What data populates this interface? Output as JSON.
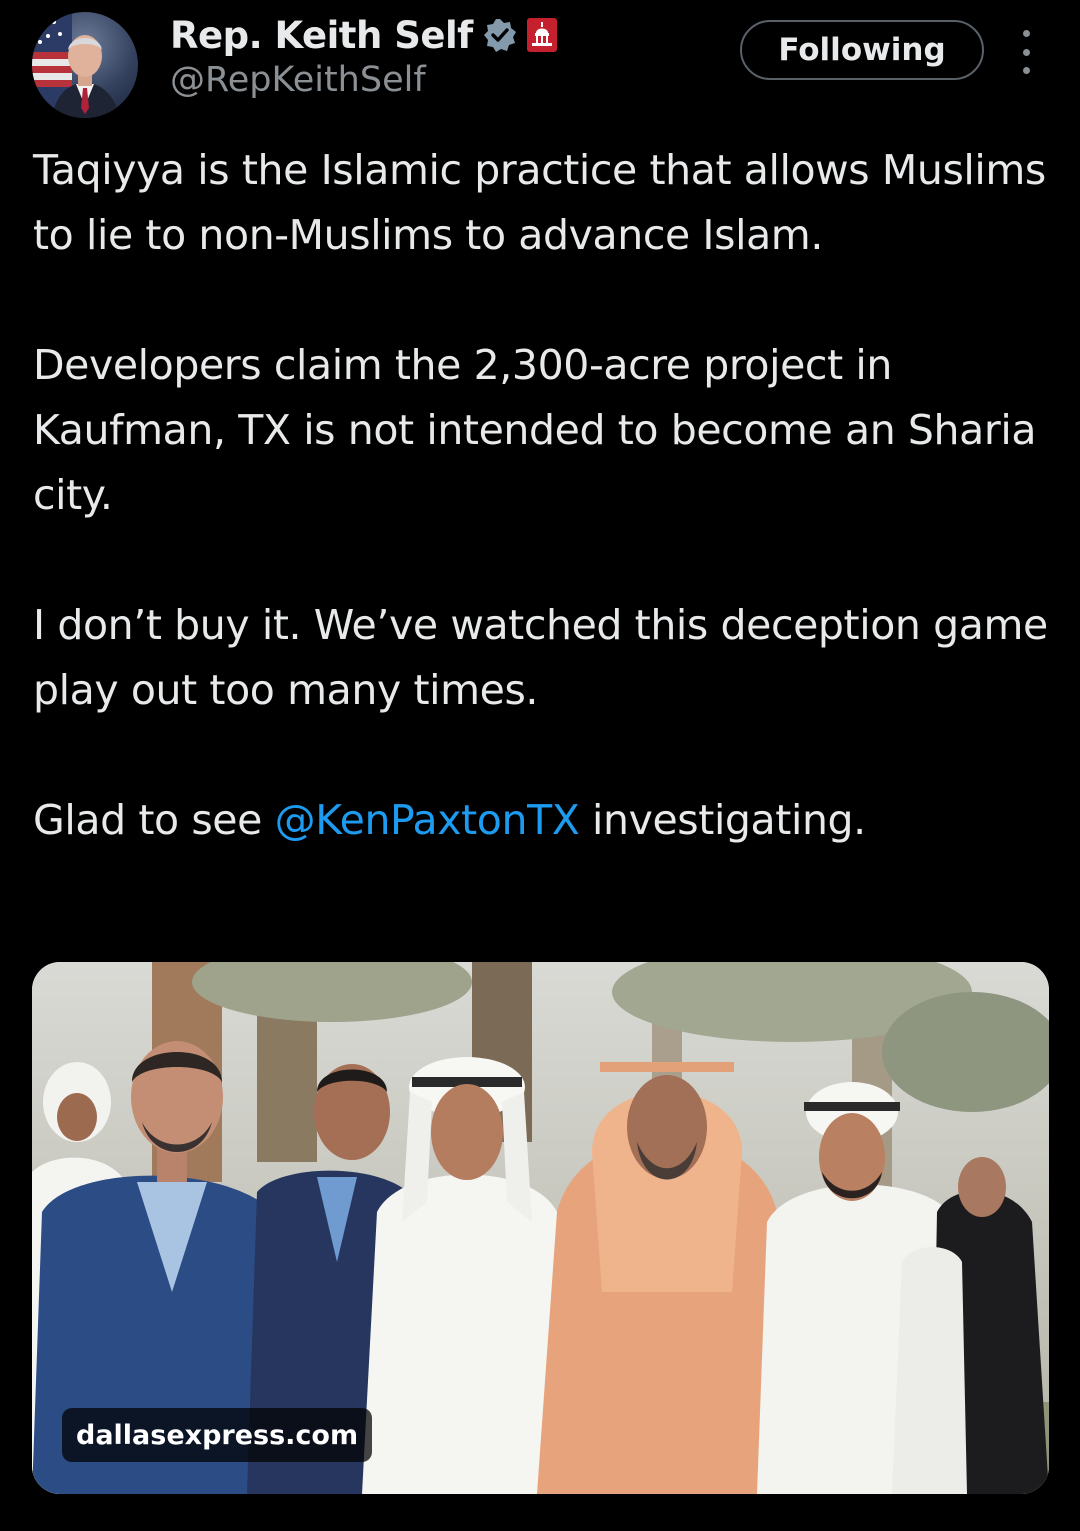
{
  "author": {
    "display_name": "Rep. Keith Self",
    "handle": "@RepKeithSelf",
    "avatar_icon": "avatar-photo",
    "badges": [
      "verified-icon",
      "capitol-icon"
    ],
    "verified_color": "#829aab",
    "capitol_badge_color": "#c4202e"
  },
  "follow_button": {
    "label": "Following"
  },
  "more_menu": {
    "icon": "more-vertical-icon"
  },
  "tweet": {
    "paragraph_1": "Taqiyya is the Islamic practice that allows Muslims to lie to non-Muslims to advance Islam.",
    "paragraph_2": "Developers claim the 2,300-acre project in Kaufman, TX is not intended to become an Sharia city.",
    "paragraph_3": "I don’t buy it. We’ve watched this deception game play out too many times.",
    "paragraph_4_before": "Glad to see ",
    "paragraph_4_mention": "@KenPaxtonTX",
    "paragraph_4_after": " investigating.",
    "mention_color": "#1d9bf0"
  },
  "media": {
    "source_label": "dallasexpress.com"
  },
  "colors": {
    "background": "#000000",
    "text": "#e7e9ea",
    "secondary_text": "#8b9095"
  }
}
